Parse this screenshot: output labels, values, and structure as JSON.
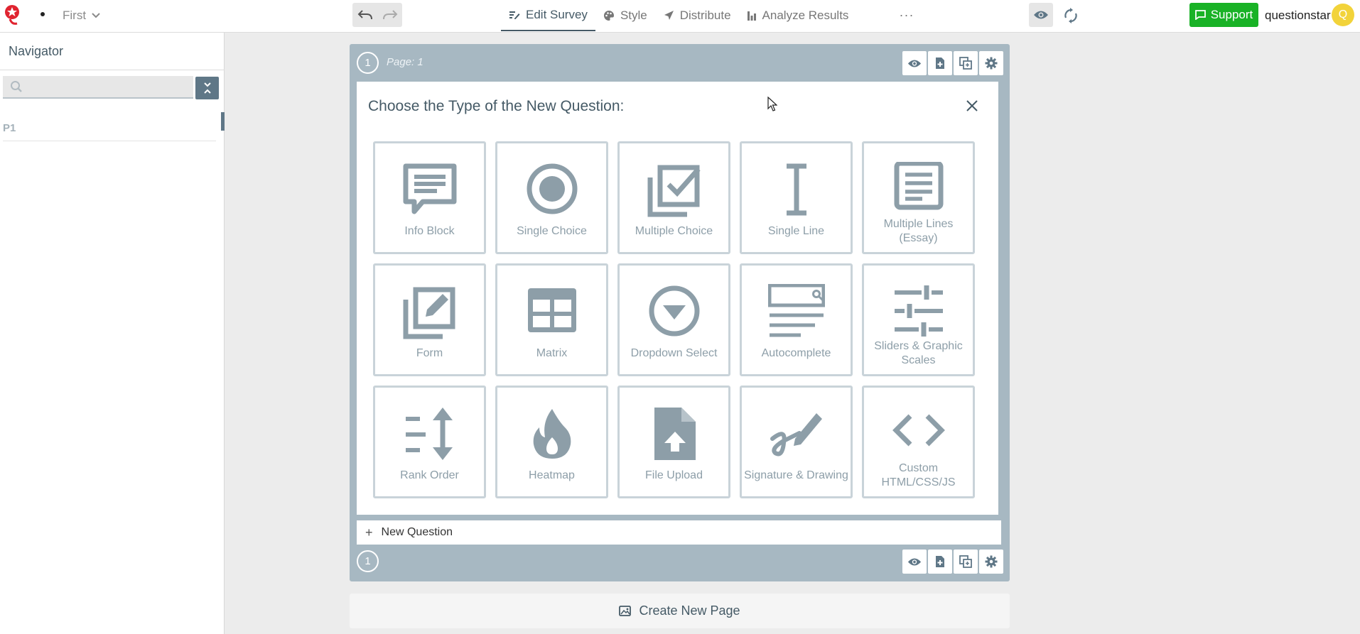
{
  "header": {
    "survey_name": "First",
    "tabs": [
      {
        "label": "Edit Survey",
        "icon": "edit-icon",
        "active": true
      },
      {
        "label": "Style",
        "icon": "palette-icon",
        "active": false
      },
      {
        "label": "Distribute",
        "icon": "send-icon",
        "active": false
      },
      {
        "label": "Analyze Results",
        "icon": "bar-chart-icon",
        "active": false
      }
    ],
    "more_label": "···",
    "support_label": "Support",
    "username": "questionstar",
    "avatar_initial": "Q"
  },
  "sidebar": {
    "title": "Navigator",
    "search_placeholder": "",
    "pages": [
      {
        "label": "P1"
      }
    ]
  },
  "page": {
    "number": "1",
    "label": "Page: 1",
    "bottom_number": "1"
  },
  "panel": {
    "title": "Choose the Type of the New Question:",
    "question_types": [
      {
        "label": "Info Block",
        "icon": "info-block-icon"
      },
      {
        "label": "Single Choice",
        "icon": "radio-icon"
      },
      {
        "label": "Multiple Choice",
        "icon": "checkbox-multiple-icon"
      },
      {
        "label": "Single Line",
        "icon": "text-cursor-icon"
      },
      {
        "label": "Multiple Lines (Essay)",
        "icon": "document-lines-icon"
      },
      {
        "label": "Form",
        "icon": "form-edit-icon"
      },
      {
        "label": "Matrix",
        "icon": "grid-icon"
      },
      {
        "label": "Dropdown Select",
        "icon": "dropdown-circle-icon"
      },
      {
        "label": "Autocomplete",
        "icon": "autocomplete-icon"
      },
      {
        "label": "Sliders & Graphic Scales",
        "icon": "sliders-icon"
      },
      {
        "label": "Rank Order",
        "icon": "rank-order-icon"
      },
      {
        "label": "Heatmap",
        "icon": "flame-icon"
      },
      {
        "label": "File Upload",
        "icon": "file-upload-icon"
      },
      {
        "label": "Signature & Drawing",
        "icon": "signature-icon"
      },
      {
        "label": "Custom HTML/CSS/JS",
        "icon": "code-icon"
      }
    ]
  },
  "new_question_label": "New Question",
  "create_page_label": "Create New Page",
  "colors": {
    "accent": "#455a66",
    "icon_gray": "#8d9ea8",
    "page_card": "#a7b8c2",
    "support_green": "#19b226",
    "avatar_yellow": "#f2d33a"
  }
}
